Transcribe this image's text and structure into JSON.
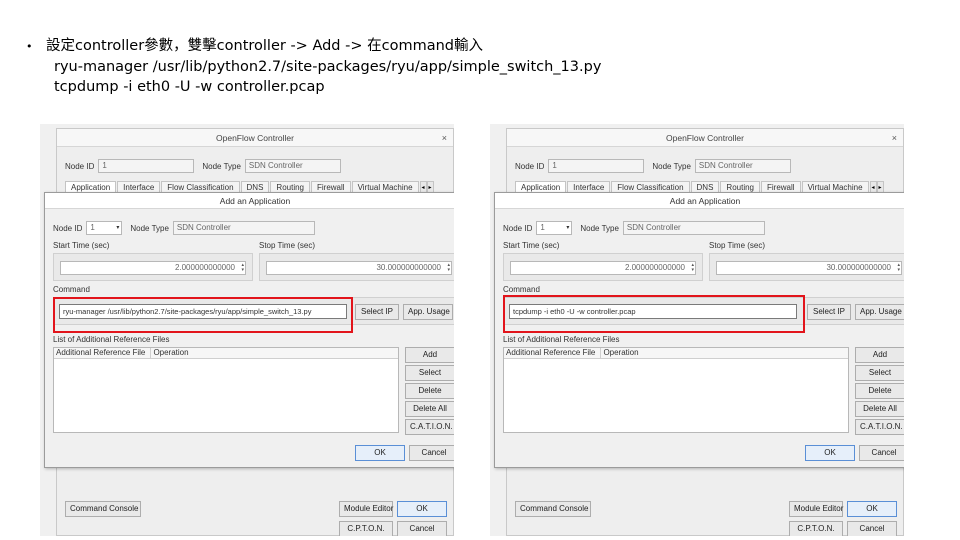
{
  "slide": {
    "bullet": "•",
    "line1": "設定controller參數，雙擊controller -> Add -> 在command輸入",
    "line2": "ryu-manager /usr/lib/python2.7/site-packages/ryu/app/simple_switch_13.py",
    "line3": "tcpdump -i eth0 -U -w controller.pcap"
  },
  "colors": {
    "highlight": "#e2141b",
    "primary_border": "#5a8fd6"
  },
  "bg_dialog": {
    "title": "OpenFlow Controller",
    "close": "×",
    "node_id_label": "Node ID",
    "node_id_value": "1",
    "node_type_label": "Node Type",
    "node_type_value": "SDN Controller",
    "tabs": [
      "Application",
      "Interface",
      "Flow Classification",
      "DNS",
      "Routing",
      "Firewall",
      "Virtual Machine"
    ],
    "tab_scroll_left": "◂",
    "tab_scroll_right": "▸",
    "command_console": "Command Console",
    "module_editor": "Module Editor",
    "ok": "OK",
    "cpton": "C.P.T.O.N.",
    "cancel": "Cancel"
  },
  "fg_dialog": {
    "title": "Add an Application",
    "close": "×",
    "node_id_label": "Node ID",
    "node_id_value": "1",
    "node_type_label": "Node Type",
    "node_type_value": "SDN Controller",
    "start_time_label": "Start Time (sec)",
    "start_time_value": "2.000000000000",
    "stop_time_label": "Stop Time (sec)",
    "stop_time_value": "30.000000000000",
    "command_label": "Command",
    "select_ip": "Select IP",
    "app_usage": "App. Usage",
    "list_label": "List of Additional Reference Files",
    "col_file": "Additional Reference File",
    "col_operation": "Operation",
    "add": "Add",
    "select": "Select",
    "delete": "Delete",
    "delete_all": "Delete All",
    "cation": "C.A.T.I.O.N.",
    "ok": "OK",
    "cancel": "Cancel"
  },
  "left_panel": {
    "command_value": "ryu-manager /usr/lib/python2.7/site-packages/ryu/app/simple_switch_13.py"
  },
  "right_panel": {
    "command_value": "tcpdump -i eth0 -U -w controller.pcap"
  }
}
